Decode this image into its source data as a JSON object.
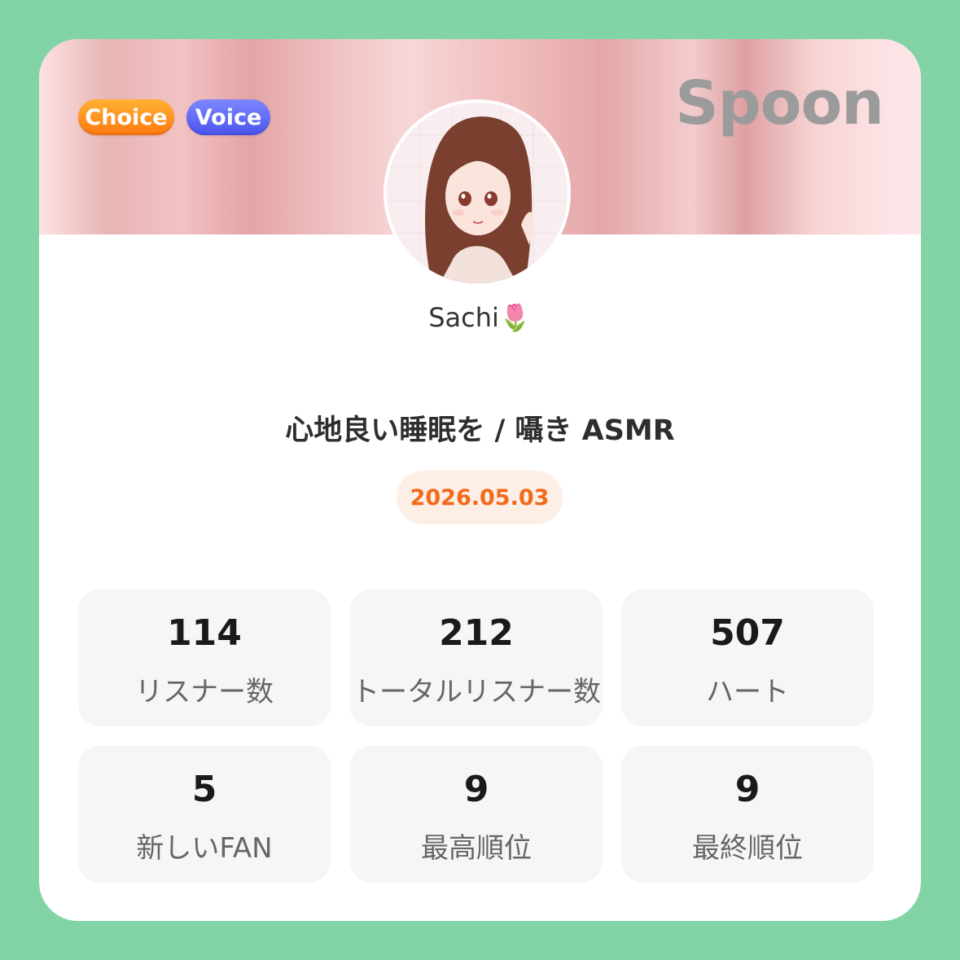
{
  "badges": {
    "choice": "Choice",
    "voice": "Voice"
  },
  "brand": {
    "logo": "Spoon"
  },
  "profile": {
    "username": "Sachi🌷"
  },
  "broadcast": {
    "title": "心地良い睡眠を / 囁き ASMR",
    "date": "2026.05.03"
  },
  "stats": [
    {
      "value": "114",
      "label": "リスナー数"
    },
    {
      "value": "212",
      "label": "トータルリスナー数"
    },
    {
      "value": "507",
      "label": "ハート"
    },
    {
      "value": "5",
      "label": "新しいFAN"
    },
    {
      "value": "9",
      "label": "最高順位"
    },
    {
      "value": "9",
      "label": "最終順位"
    }
  ],
  "colors": {
    "background": "#82d4a7",
    "date_text": "#f26a1b",
    "choice_badge": "#ff8a1f",
    "voice_badge": "#5a64f5"
  }
}
